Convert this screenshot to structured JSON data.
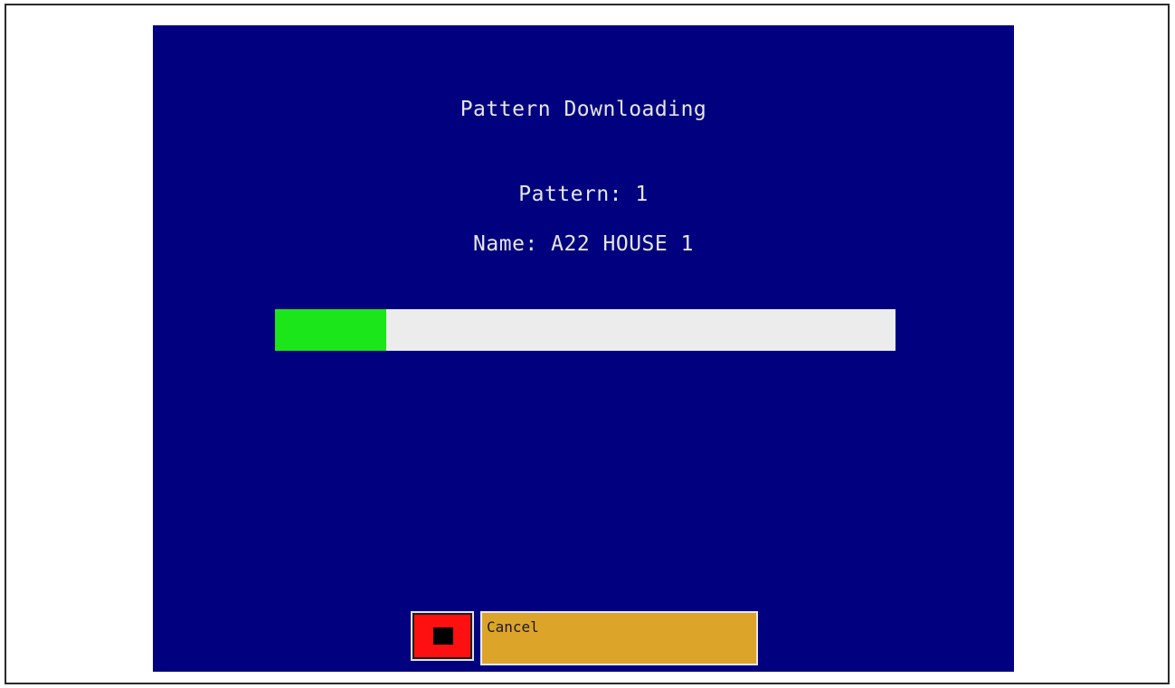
{
  "dialog": {
    "title": "Pattern Downloading",
    "pattern_line": "Pattern: 1",
    "name_line": "Name: A22 HOUSE 1"
  },
  "progress": {
    "fraction": 0.18,
    "fill_color": "#1ae61a",
    "track_color": "#ececec"
  },
  "buttons": {
    "stop_icon": "stop-square-icon",
    "cancel_label": "Cancel"
  },
  "colors": {
    "background": "#010180",
    "text": "#e6e6e6",
    "stop_button": "#ff1010",
    "cancel_button": "#dca52a"
  }
}
